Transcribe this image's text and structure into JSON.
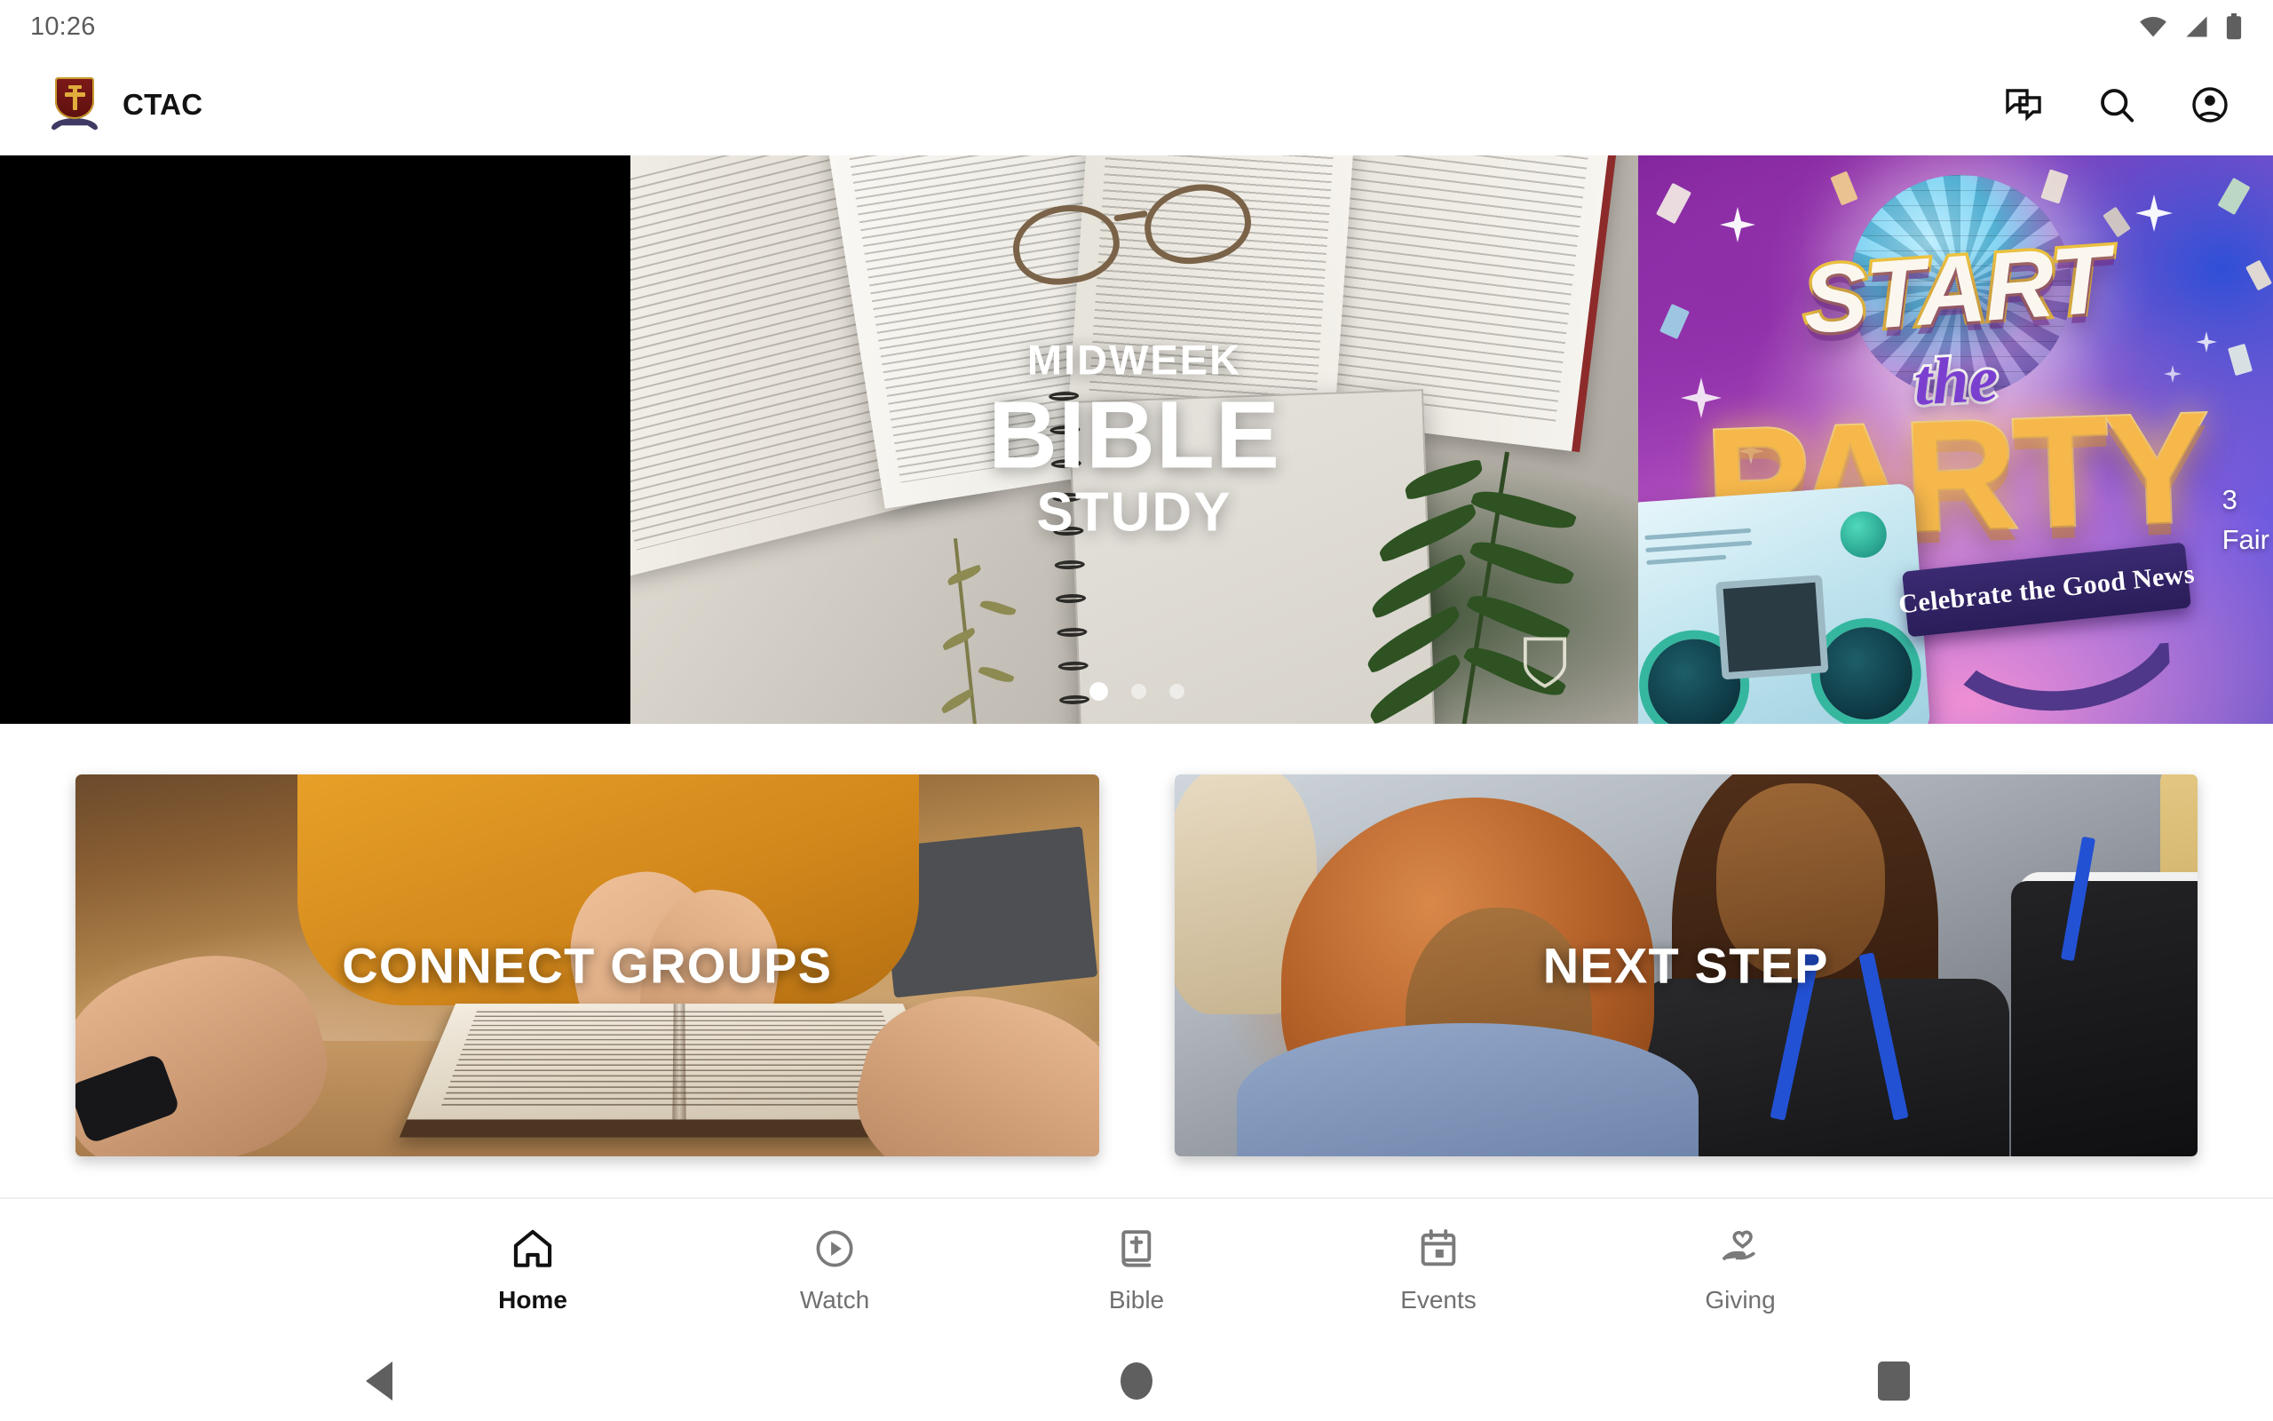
{
  "status_bar": {
    "time": "10:26",
    "icons": [
      "wifi-icon",
      "cell-signal-icon",
      "battery-icon"
    ]
  },
  "app_header": {
    "logo_icon": "ctac-crest-logo",
    "brand_name": "CTAC",
    "actions": [
      {
        "name": "chat-icon",
        "label": "Chat"
      },
      {
        "name": "search-icon",
        "label": "Search"
      },
      {
        "name": "account-circle-icon",
        "label": "Account"
      }
    ]
  },
  "hero_carousel": {
    "slides": [
      {
        "id": "slide-blank",
        "kind": "blank",
        "title": ""
      },
      {
        "id": "slide-bible-study",
        "kind": "bible-study",
        "line1": "MIDWEEK",
        "line2": "BIBLE",
        "line3": "STUDY",
        "watermark_icon": "shield-outline-icon"
      },
      {
        "id": "slide-start-the-party",
        "kind": "party",
        "word1": "START",
        "word2": "the",
        "word3": "PARTY",
        "ribbon": "Celebrate the Good News",
        "side_line1": "3",
        "side_line2": "Fair"
      }
    ],
    "dots": {
      "count": 3,
      "active_index": 0
    }
  },
  "cards": [
    {
      "id": "connect-groups",
      "label": "CONNECT GROUPS"
    },
    {
      "id": "next-step",
      "label": "NEXT STEP"
    }
  ],
  "bottom_nav": {
    "active": "Home",
    "items": [
      {
        "label": "Home",
        "icon": "home-icon",
        "active": true
      },
      {
        "label": "Watch",
        "icon": "play-circle-icon",
        "active": false
      },
      {
        "label": "Bible",
        "icon": "bible-book-icon",
        "active": false
      },
      {
        "label": "Events",
        "icon": "calendar-icon",
        "active": false
      },
      {
        "label": "Giving",
        "icon": "hand-heart-icon",
        "active": false
      }
    ]
  },
  "android_nav": {
    "items": [
      {
        "label": "Back",
        "icon": "triangle-back-icon"
      },
      {
        "label": "Home",
        "icon": "circle-home-icon"
      },
      {
        "label": "Recents",
        "icon": "square-recents-icon"
      }
    ]
  },
  "colors": {
    "brand_crest_red": "#7d1a18",
    "brand_crest_gold": "#e0ad3c",
    "nav_active": "#111111",
    "nav_inactive": "#707070",
    "status_icon": "#5f5f5f"
  }
}
